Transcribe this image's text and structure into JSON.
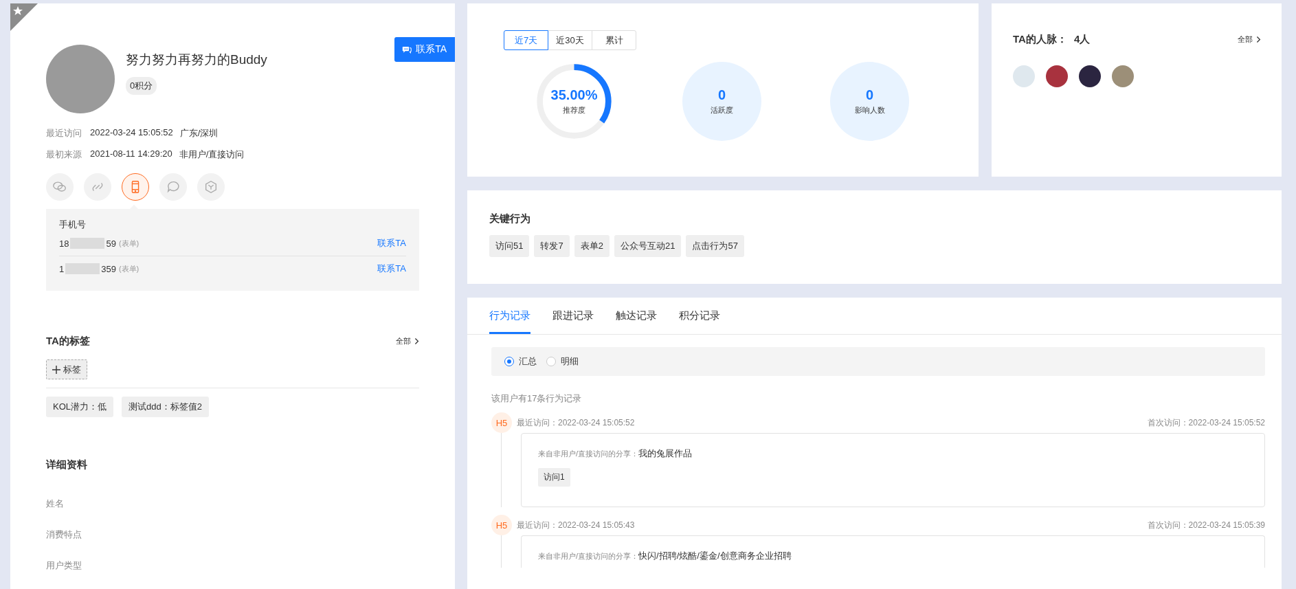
{
  "profile": {
    "starred": true,
    "name": "努力努力再努力的Buddy",
    "points": "0积分",
    "contact_button": "联系TA",
    "info": [
      {
        "label": "最近访问",
        "value": "2022-03-24 15:05:52",
        "extra": "广东/深圳"
      },
      {
        "label": "最初来源",
        "value": "2021-08-11 14:29:20",
        "extra": "非用户/直接访问"
      }
    ],
    "channels": [
      {
        "kind": "chat",
        "selected": false
      },
      {
        "kind": "link",
        "selected": false
      },
      {
        "kind": "phone",
        "selected": true
      },
      {
        "kind": "bubble",
        "selected": false
      },
      {
        "kind": "cube",
        "selected": false
      }
    ],
    "phone_panel": {
      "title": "手机号",
      "numbers": [
        {
          "prefix": "18",
          "suffix": "59",
          "source": "(表单)",
          "action": "联系TA"
        },
        {
          "prefix": "1",
          "suffix": "359",
          "source": "(表单)",
          "action": "联系TA"
        }
      ]
    },
    "tags": {
      "title": "TA的标签",
      "more": "全部",
      "add": "标签",
      "items": [
        "KOL潜力：低",
        "测试ddd：标签值2"
      ]
    },
    "details": {
      "title": "详细资料",
      "fields": [
        "姓名",
        "消费特点",
        "用户类型"
      ]
    }
  },
  "stats": {
    "ranges": [
      {
        "label": "近7天",
        "selected": true
      },
      {
        "label": "近30天",
        "selected": false
      },
      {
        "label": "累计",
        "selected": false
      }
    ],
    "metrics": [
      {
        "kind": "ring",
        "value": "35.00%",
        "label": "推荐度",
        "level": 0.35
      },
      {
        "kind": "bubble",
        "value": "0",
        "label": "活跃度"
      },
      {
        "kind": "bubble",
        "value": "0",
        "label": "影响人数"
      }
    ]
  },
  "network": {
    "title": "TA的人脉：",
    "count": "4人",
    "more": "全部",
    "avatars": [
      {
        "color": "#dfe8ee"
      },
      {
        "color": "#a8323e"
      },
      {
        "color": "#2b2540"
      },
      {
        "color": "#9c8f78"
      }
    ]
  },
  "key_actions": {
    "title": "关键行为",
    "items": [
      "访问51",
      "转发7",
      "表单2",
      "公众号互动21",
      "点击行为57"
    ]
  },
  "records": {
    "tabs": [
      {
        "label": "行为记录",
        "selected": true
      },
      {
        "label": "跟进记录",
        "selected": false
      },
      {
        "label": "触达记录",
        "selected": false
      },
      {
        "label": "积分记录",
        "selected": false
      }
    ],
    "modes": [
      {
        "label": "汇总",
        "selected": true
      },
      {
        "label": "明细",
        "selected": false
      }
    ],
    "summary": "该用户有17条行为记录",
    "entries": [
      {
        "badge": "H5",
        "last_visit": "最近访问：2022-03-24 15:05:52",
        "first_visit": "首次访问：2022-03-24 15:05:52",
        "source_label": "来自非用户/直接访问的分享：",
        "source_title": "我的兔展作品",
        "chips": [
          "访问1"
        ]
      },
      {
        "badge": "H5",
        "last_visit": "最近访问：2022-03-24 15:05:43",
        "first_visit": "首次访问：2022-03-24 15:05:39",
        "source_label": "来自非用户/直接访问的分享：",
        "source_title": "快闪/招聘/炫酷/鎏金/创意商务企业招聘"
      }
    ]
  }
}
